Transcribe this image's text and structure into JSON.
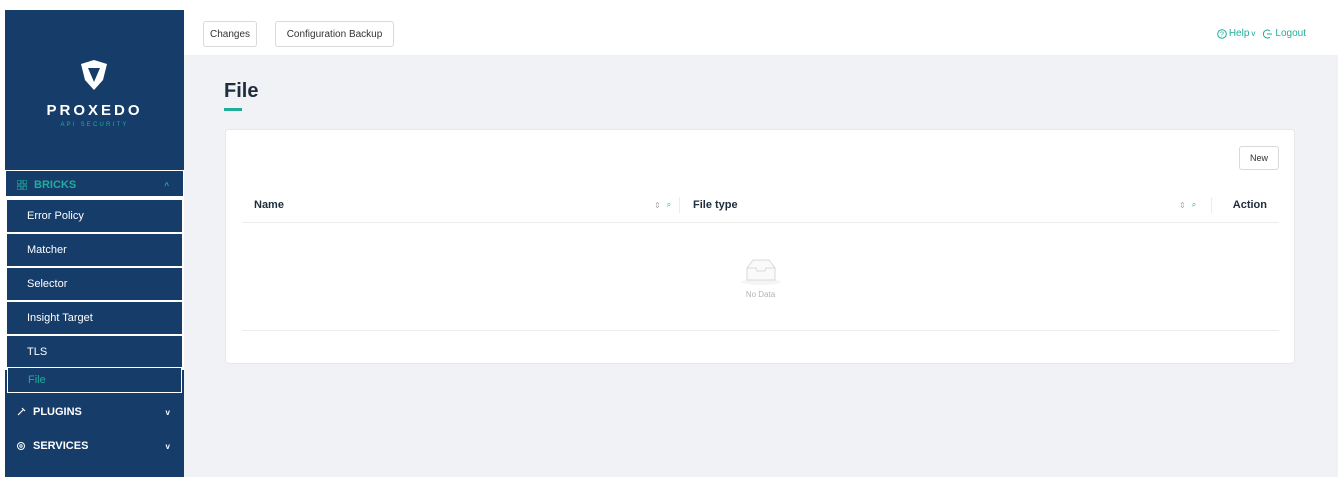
{
  "brand": {
    "name": "PROXEDO",
    "tagline": "API SECURITY",
    "accent": "#1fae9a",
    "sidebar_bg": "#163c6a"
  },
  "sidebar": {
    "groups": [
      {
        "label": "BRICKS",
        "icon": "grid-icon",
        "expanded": true
      },
      {
        "label": "PLUGINS",
        "icon": "plug-icon",
        "expanded": false
      },
      {
        "label": "SERVICES",
        "icon": "gear-icon",
        "expanded": false
      }
    ],
    "bricks_items": [
      {
        "label": "Error Policy"
      },
      {
        "label": "Matcher"
      },
      {
        "label": "Selector"
      },
      {
        "label": "Insight Target"
      },
      {
        "label": "TLS"
      },
      {
        "label": "File",
        "active": true
      }
    ]
  },
  "topbar": {
    "changes_label": "Changes",
    "backup_label": "Configuration Backup",
    "help_label": "Help",
    "logout_label": "Logout"
  },
  "main": {
    "title": "File",
    "new_label": "New",
    "table": {
      "columns": [
        "Name",
        "File type",
        "Action"
      ],
      "rows": [],
      "empty_text": "No Data"
    }
  }
}
